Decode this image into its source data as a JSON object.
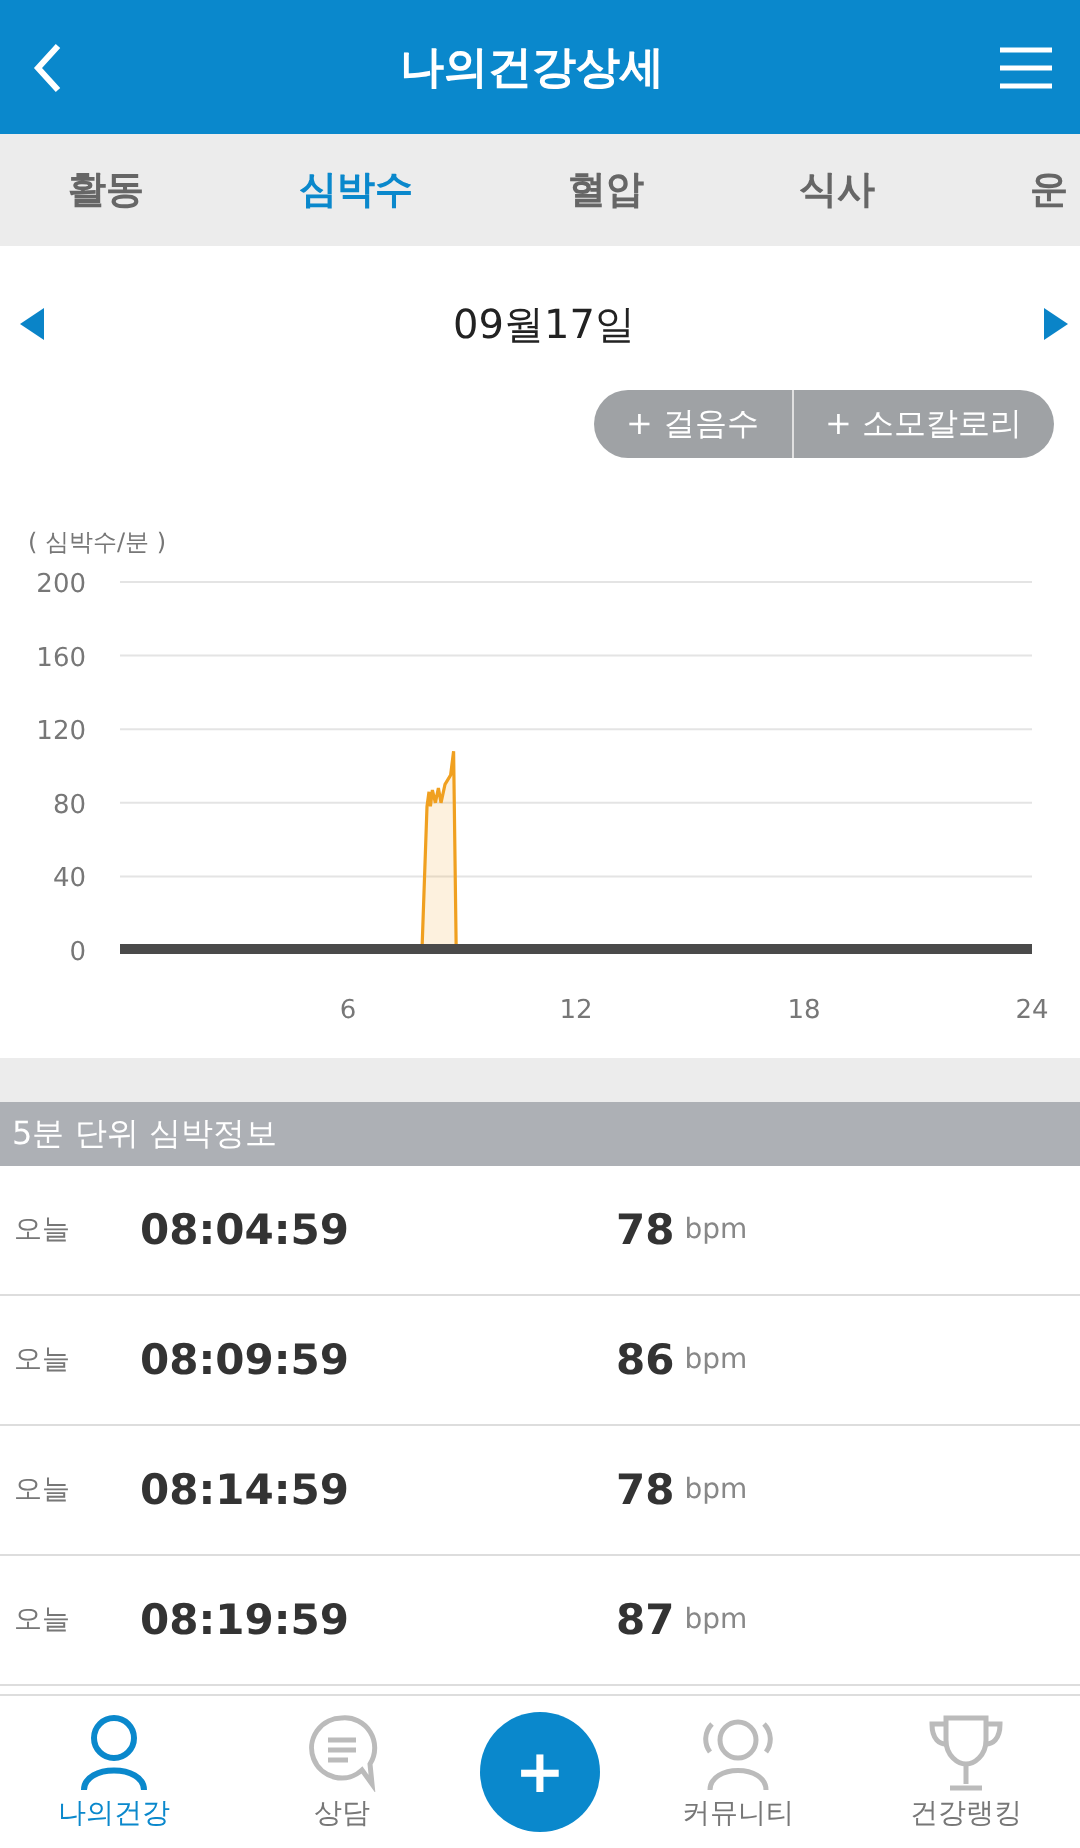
{
  "header": {
    "title": "나의건강상세"
  },
  "tabs": [
    {
      "label": "활동",
      "selected": false
    },
    {
      "label": "심박수",
      "selected": true
    },
    {
      "label": "혈압",
      "selected": false
    },
    {
      "label": "식사",
      "selected": false
    },
    {
      "label": "운",
      "selected": false
    }
  ],
  "date": {
    "label": "09월17일"
  },
  "toggles": [
    "+ 걸음수",
    "+ 소모칼로리"
  ],
  "chart": {
    "chart_data": {
      "type": "area",
      "ylabel": "( 심박수/분 )",
      "x": [
        7.95,
        8.08,
        8.13,
        8.17,
        8.22,
        8.3,
        8.38,
        8.45,
        8.55,
        8.7,
        8.78,
        8.85
      ],
      "series": [
        {
          "color": "#f0a020",
          "values": [
            0,
            78,
            86,
            78,
            87,
            80,
            88,
            80,
            90,
            95,
            108,
            0
          ]
        }
      ],
      "grid": true,
      "xlim": [
        0,
        24
      ],
      "ylim": [
        0,
        200
      ],
      "xticks": [
        6,
        12,
        18,
        24
      ],
      "yticks": [
        0,
        40,
        80,
        120,
        160,
        200
      ]
    }
  },
  "section": {
    "title": "5분 단위 심박정보"
  },
  "rows": [
    {
      "day": "오늘",
      "time": "08:04:59",
      "value": "78",
      "unit": "bpm"
    },
    {
      "day": "오늘",
      "time": "08:09:59",
      "value": "86",
      "unit": "bpm"
    },
    {
      "day": "오늘",
      "time": "08:14:59",
      "value": "78",
      "unit": "bpm"
    },
    {
      "day": "오늘",
      "time": "08:19:59",
      "value": "87",
      "unit": "bpm"
    }
  ],
  "nav": [
    {
      "kind": "person",
      "label": "나의건강",
      "selected": true
    },
    {
      "kind": "chat",
      "label": "상담",
      "selected": false
    },
    {
      "kind": "fab",
      "label": "+",
      "selected": false
    },
    {
      "kind": "group",
      "label": "커뮤니티",
      "selected": false
    },
    {
      "kind": "trophy",
      "label": "건강랭킹",
      "selected": false
    }
  ]
}
